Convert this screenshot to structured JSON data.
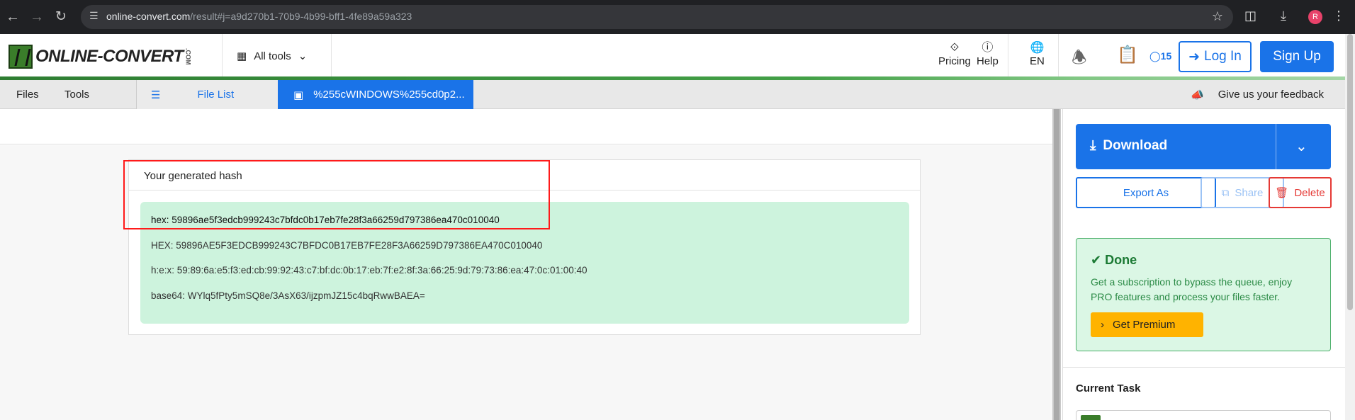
{
  "browser": {
    "url_domain": "online-convert.com",
    "url_path": "/result#j=a9d270b1-70b9-4b99-bff1-4fe89a59a323",
    "profile_initial": "R"
  },
  "header": {
    "logo_text": "ONLINE-CONVERT",
    "logo_suffix": ".COM",
    "all_tools_label": "All tools",
    "pricing_label": "Pricing",
    "help_label": "Help",
    "language_label": "EN",
    "credits_count": "15",
    "login_label": "Log In",
    "signup_label": "Sign Up"
  },
  "tabs": {
    "files": "Files",
    "tools": "Tools",
    "file_list": "File List",
    "active_file": "%255cWINDOWS%255cd0p2...",
    "feedback": "Give us your feedback"
  },
  "result": {
    "title": "Your generated hash",
    "lines": [
      "hex: 59896ae5f3edcb999243c7bfdc0b17eb7fe28f3a66259d797386ea470c010040",
      "HEX: 59896AE5F3EDCB999243C7BFDC0B17EB7FE28F3A66259D797386EA470C010040",
      "h:e:x: 59:89:6a:e5:f3:ed:cb:99:92:43:c7:bf:dc:0b:17:eb:7f:e2:8f:3a:66:25:9d:79:73:86:ea:47:0c:01:00:40",
      "base64: WYlq5fPty5mSQ8e/3AsX63/ijzpmJZ15c4bqRwwBAEA="
    ]
  },
  "sidebar": {
    "download_label": "Download",
    "export_label": "Export As",
    "share_label": "Share",
    "delete_label": "Delete",
    "done_title": "Done",
    "done_text": "Get a subscription to bypass the queue, enjoy PRO features and process your files faster.",
    "premium_label": "Get Premium",
    "current_task_label": "Current Task"
  },
  "colors": {
    "accent": "#1a73e8",
    "success_bg": "#cdf3dd",
    "danger": "#e53935",
    "premium": "#ffb300",
    "highlight_box": "#ff1a1a"
  }
}
